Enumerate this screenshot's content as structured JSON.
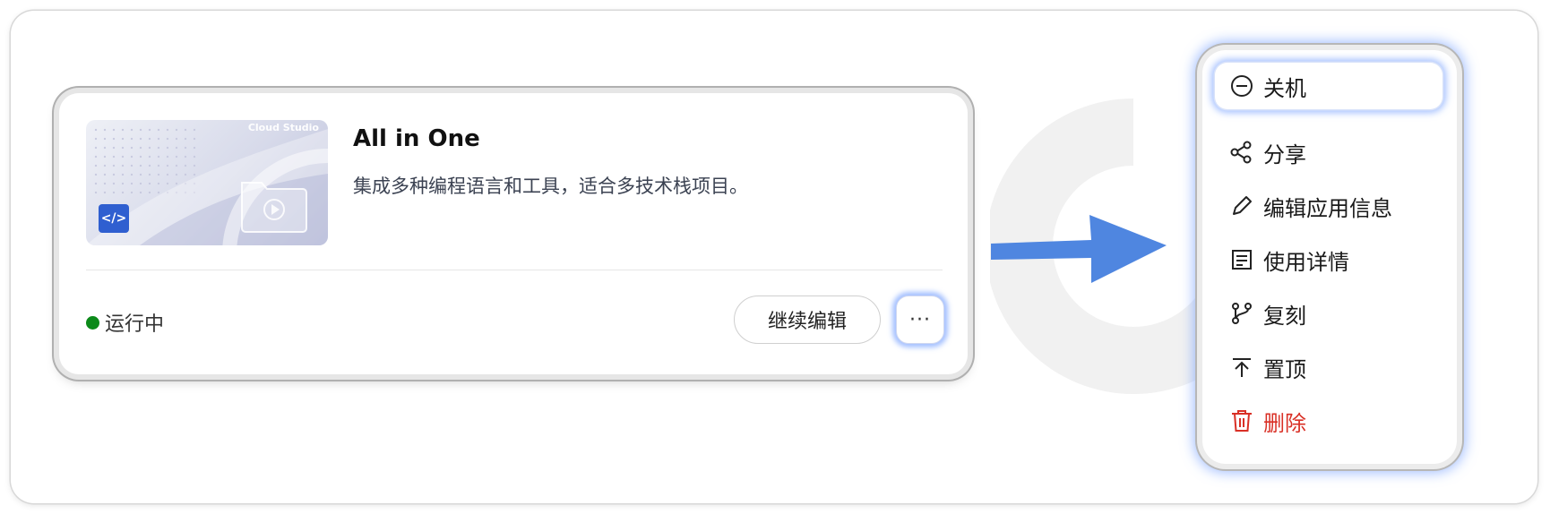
{
  "card": {
    "thumbnail_brand": "Cloud Studio",
    "badge_glyph": "</>",
    "title": "All in One",
    "description": "集成多种编程语言和工具，适合多技术栈项目。",
    "status": "运行中",
    "status_color": "#0c8a1a",
    "continue_label": "继续编辑",
    "more_label": "···"
  },
  "menu": {
    "items": [
      {
        "label": "关机",
        "icon": "power-off-icon",
        "active": true
      },
      {
        "label": "分享",
        "icon": "share-icon"
      },
      {
        "label": "编辑应用信息",
        "icon": "pencil-icon"
      },
      {
        "label": "使用详情",
        "icon": "document-icon"
      },
      {
        "label": "复刻",
        "icon": "fork-icon"
      },
      {
        "label": "置顶",
        "icon": "pin-top-icon"
      },
      {
        "label": "删除",
        "icon": "trash-icon",
        "danger": true,
        "color": "#d93026"
      }
    ]
  },
  "colors": {
    "accent_glow": "#5a8cff",
    "arrow": "#4f86e0",
    "badge": "#2f5fd0"
  }
}
